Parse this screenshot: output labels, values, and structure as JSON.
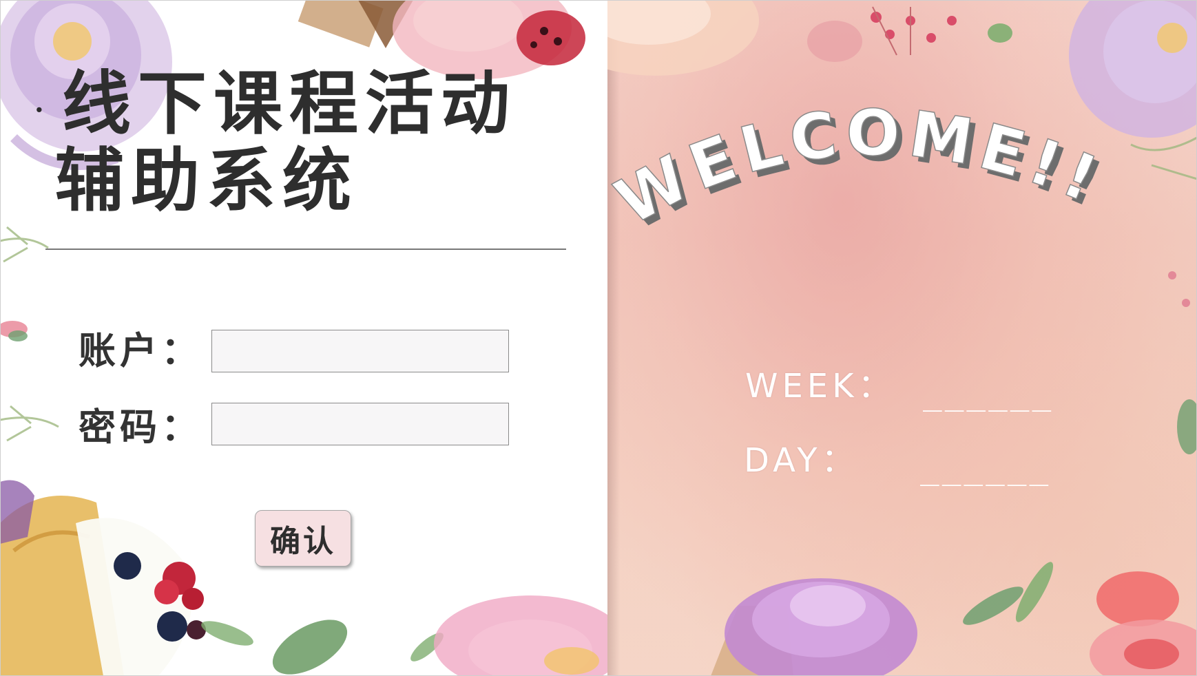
{
  "title": {
    "bullet": "·",
    "line1": "线下课程活动",
    "line2": "辅助系统"
  },
  "form": {
    "account_label": "账户：",
    "password_label": "密码：",
    "account_value": "",
    "password_value": "",
    "confirm_label": "确认"
  },
  "welcome_panel": {
    "welcome_text": "WELCOME!!",
    "week_label": "WEEK：",
    "week_value": "______",
    "day_label": "DAY：",
    "day_value": "______"
  },
  "colors": {
    "title_text": "#2e2e2e",
    "right_panel_bg": "#f1c8bf",
    "confirm_button_bg": "#f6e0e2",
    "input_bg": "#f7f6f7"
  },
  "decorations": [
    "watercolor-flowers",
    "cupcake-illustrations",
    "berries",
    "leaves"
  ]
}
